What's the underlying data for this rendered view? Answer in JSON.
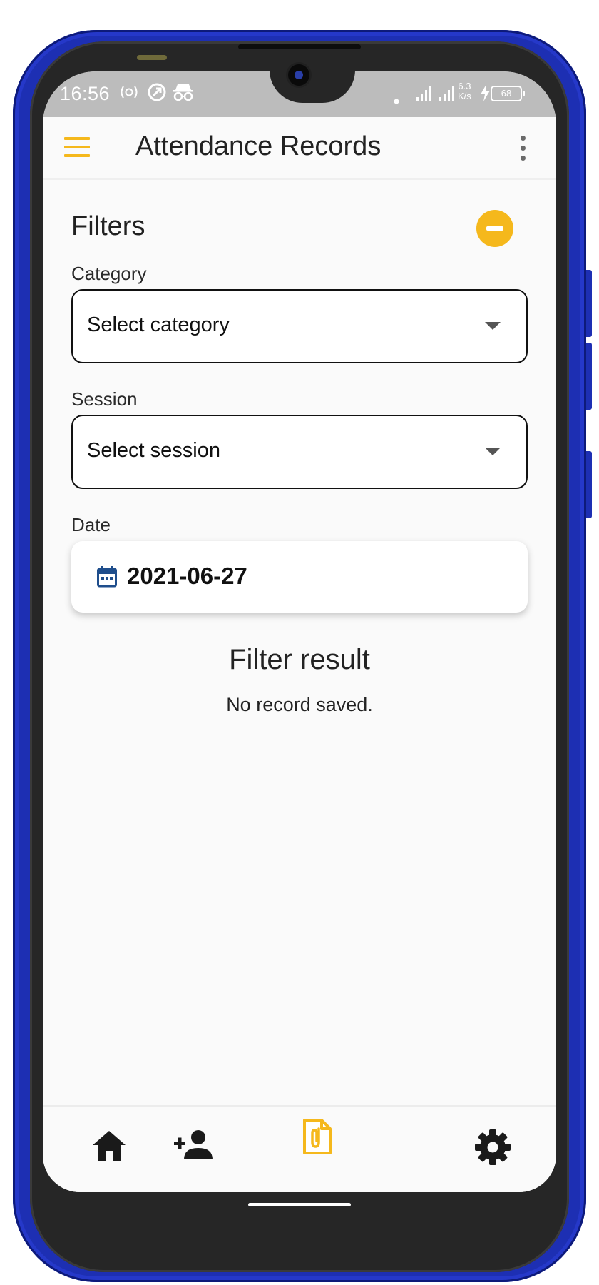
{
  "status_bar": {
    "time": "16:56",
    "net_speed_value": "6.3",
    "net_speed_unit": "K/s",
    "battery": "68"
  },
  "app_bar": {
    "title": "Attendance Records"
  },
  "filters": {
    "title": "Filters",
    "category": {
      "label": "Category",
      "value": "Select category"
    },
    "session": {
      "label": "Session",
      "value": "Select session"
    },
    "date": {
      "label": "Date",
      "value": "2021-06-27"
    }
  },
  "result": {
    "title": "Filter result",
    "message": "No record saved."
  },
  "bottom_nav": {
    "items": [
      {
        "icon": "home-icon",
        "active": false
      },
      {
        "icon": "add-person-icon",
        "active": false
      },
      {
        "icon": "records-file-icon",
        "active": true
      },
      {
        "icon": "settings-icon",
        "active": false
      }
    ]
  },
  "colors": {
    "accent": "#F5B81C",
    "calendar_icon": "#1F4E8C",
    "phone_frame": "#1D2FB3"
  }
}
